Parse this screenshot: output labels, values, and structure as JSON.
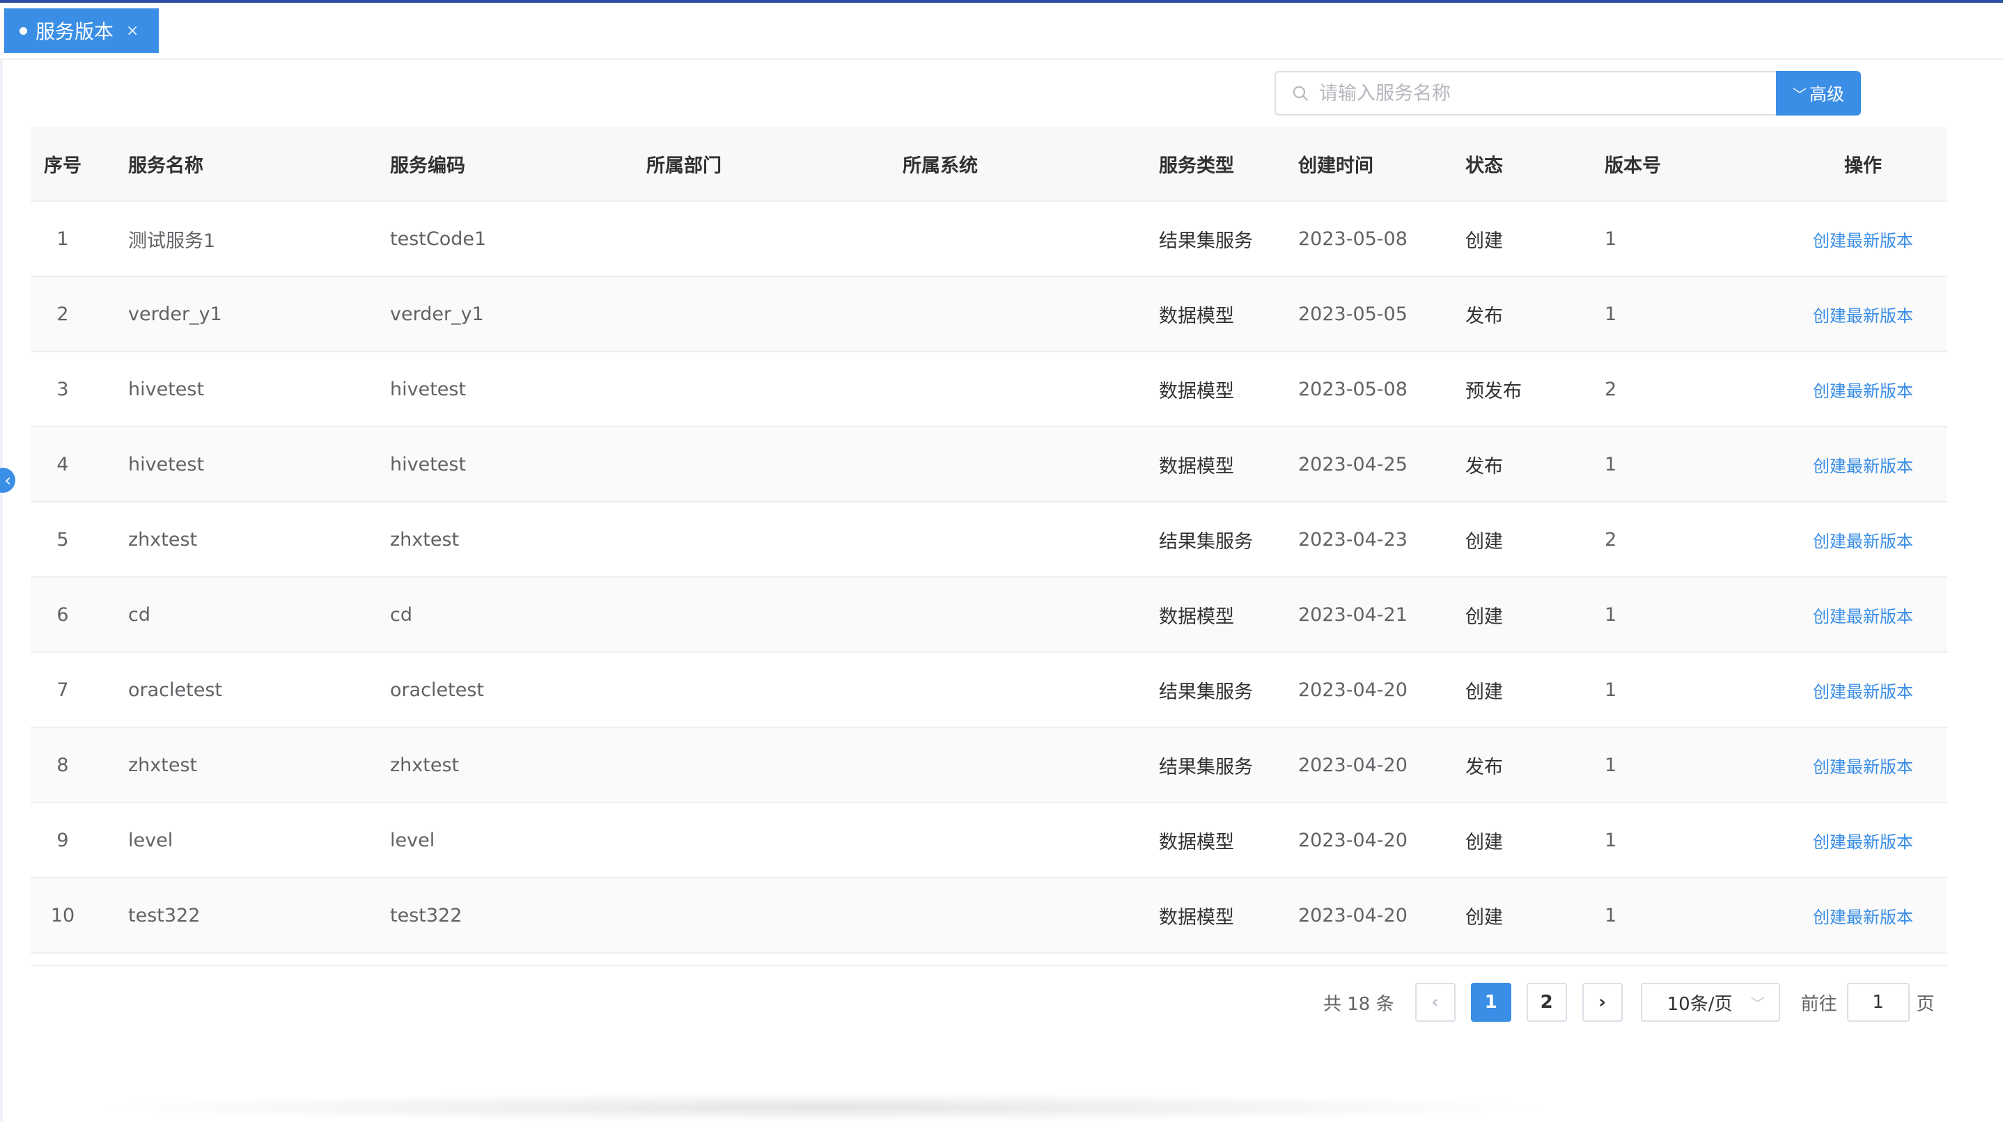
{
  "tab": {
    "label": "服务版本",
    "close": "×"
  },
  "search": {
    "placeholder": "请输入服务名称",
    "advanced_label": "高级"
  },
  "table": {
    "columns": [
      "序号",
      "服务名称",
      "服务编码",
      "所属部门",
      "所属系统",
      "服务类型",
      "创建时间",
      "状态",
      "版本号",
      "操作"
    ],
    "rows": [
      {
        "index": "1",
        "name": "测试服务1",
        "code": "testCode1",
        "dept": "",
        "system": "",
        "type": "结果集服务",
        "created": "2023-05-08",
        "status": "创建",
        "version": "1",
        "action": "创建最新版本"
      },
      {
        "index": "2",
        "name": "verder_y1",
        "code": "verder_y1",
        "dept": "",
        "system": "",
        "type": "数据模型",
        "created": "2023-05-05",
        "status": "发布",
        "version": "1",
        "action": "创建最新版本"
      },
      {
        "index": "3",
        "name": "hivetest",
        "code": "hivetest",
        "dept": "",
        "system": "",
        "type": "数据模型",
        "created": "2023-05-08",
        "status": "预发布",
        "version": "2",
        "action": "创建最新版本"
      },
      {
        "index": "4",
        "name": "hivetest",
        "code": "hivetest",
        "dept": "",
        "system": "",
        "type": "数据模型",
        "created": "2023-04-25",
        "status": "发布",
        "version": "1",
        "action": "创建最新版本"
      },
      {
        "index": "5",
        "name": "zhxtest",
        "code": "zhxtest",
        "dept": "",
        "system": "",
        "type": "结果集服务",
        "created": "2023-04-23",
        "status": "创建",
        "version": "2",
        "action": "创建最新版本"
      },
      {
        "index": "6",
        "name": "cd",
        "code": "cd",
        "dept": "",
        "system": "",
        "type": "数据模型",
        "created": "2023-04-21",
        "status": "创建",
        "version": "1",
        "action": "创建最新版本"
      },
      {
        "index": "7",
        "name": "oracletest",
        "code": "oracletest",
        "dept": "",
        "system": "",
        "type": "结果集服务",
        "created": "2023-04-20",
        "status": "创建",
        "version": "1",
        "action": "创建最新版本"
      },
      {
        "index": "8",
        "name": "zhxtest",
        "code": "zhxtest",
        "dept": "",
        "system": "",
        "type": "结果集服务",
        "created": "2023-04-20",
        "status": "发布",
        "version": "1",
        "action": "创建最新版本"
      },
      {
        "index": "9",
        "name": "level",
        "code": "level",
        "dept": "",
        "system": "",
        "type": "数据模型",
        "created": "2023-04-20",
        "status": "创建",
        "version": "1",
        "action": "创建最新版本"
      },
      {
        "index": "10",
        "name": "test322",
        "code": "test322",
        "dept": "",
        "system": "",
        "type": "数据模型",
        "created": "2023-04-20",
        "status": "创建",
        "version": "1",
        "action": "创建最新版本"
      }
    ]
  },
  "pagination": {
    "total_text": "共 18 条",
    "prev": "‹",
    "pages": [
      "1",
      "2"
    ],
    "current": "1",
    "next": "›",
    "page_size": "10条/页",
    "goto_label": "前往",
    "goto_value": "1",
    "page_suffix": "页"
  },
  "colors": {
    "accent": "#3a8ee6",
    "header_bg": "#f8f8f9",
    "top_bar": "#2d4fa3"
  }
}
